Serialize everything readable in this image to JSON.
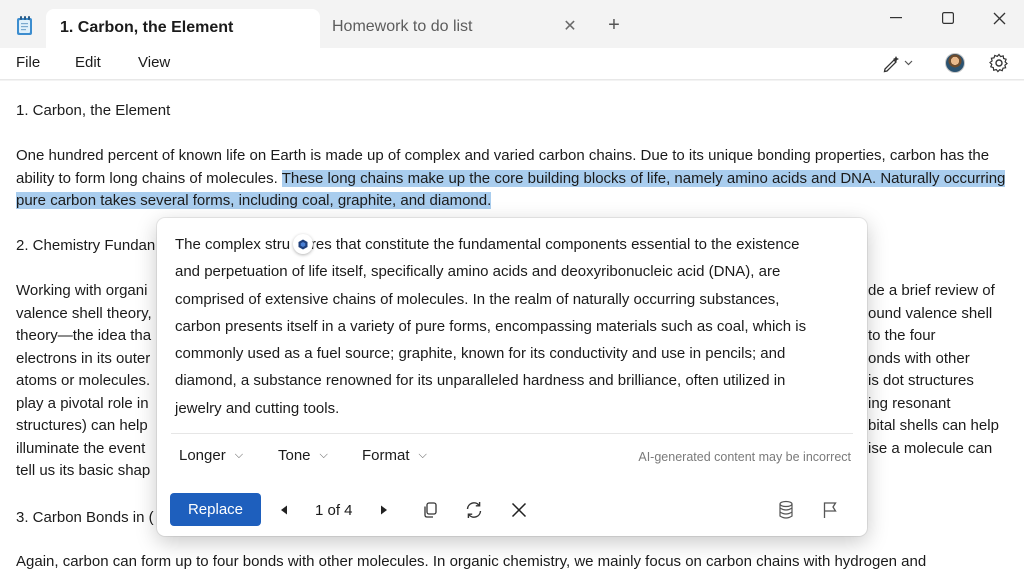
{
  "tabs": [
    {
      "label": "1. Carbon, the Element",
      "active": true
    },
    {
      "label": "Homework to do list",
      "active": false
    }
  ],
  "icons": {
    "app": "notepad-icon",
    "tab_close": "close-icon",
    "new_tab": "plus-icon",
    "minimize": "minimize-icon",
    "maximize": "maximize-icon",
    "close_window": "close-icon",
    "rewrite": "pen-sparkle-icon",
    "settings": "gear-icon",
    "copilot": "hexagon-icon"
  },
  "menu": {
    "file": "File",
    "edit": "Edit",
    "view": "View"
  },
  "document": {
    "heading1": "1. Carbon, the Element",
    "para1_start": "One hundred percent of known life on Earth is made up of complex and varied carbon chains. Due to its unique bonding properties, carbon has the ability to form long chains of molecules. ",
    "para1_selected": "These long chains make up the core building blocks of life, namely amino acids and DNA. Naturally occurring pure carbon takes several forms, including coal, graphite, and diamond.",
    "heading2": "2. Chemistry Fundan",
    "para2_left": [
      "Working with organi",
      "valence shell theory,",
      "theory—the idea tha",
      "electrons in its outer",
      "atoms or molecules.",
      "play a pivotal role in",
      "structures) can help",
      "illuminate the event",
      "tell us its basic shap"
    ],
    "para2_right": [
      "de a brief review of",
      "ound valence shell",
      "to the four",
      "onds with other",
      "is dot structures",
      "ing resonant",
      "bital shells can help",
      "ise a molecule can",
      ""
    ],
    "heading3": "3. Carbon Bonds in (",
    "para3": "Again, carbon can form up to four bonds with other molecules. In organic chemistry, we mainly focus on carbon chains with hydrogen and"
  },
  "rewrite": {
    "text_lines": [
      "The complex stru   ures that constitute the fundamental components essential to the existence",
      "and perpetuation of life itself, specifically amino acids and deoxyribonucleic acid (DNA), are",
      "comprised of extensive chains of molecules. In the realm of naturally occurring substances,",
      "carbon presents itself in a variety of pure forms, encompassing materials such as coal, which is",
      "commonly used as a fuel source; graphite, known for its conductivity and use in pencils; and",
      "diamond, a substance renowned for its unparalleled hardness and brilliance, often utilized in",
      "jewelry and cutting tools."
    ],
    "options": {
      "longer": "Longer",
      "tone": "Tone",
      "format": "Format"
    },
    "disclaimer": "AI-generated content may be incorrect",
    "replace_label": "Replace",
    "page_indicator": "1 of 4",
    "action_icons": [
      "previous-icon",
      "next-icon",
      "copy-icon",
      "refresh-icon",
      "close-icon",
      "database-icon",
      "flag-icon"
    ]
  },
  "colors": {
    "selection": "#a9cdee",
    "accent": "#1e5fbd"
  }
}
